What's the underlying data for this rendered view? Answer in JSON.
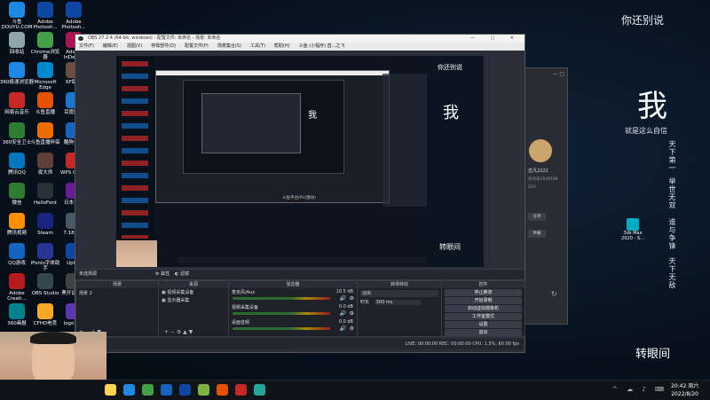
{
  "desktop": {
    "icons": [
      {
        "label": "斗鱼 DOUYU.COM",
        "color": "#1e88e5"
      },
      {
        "label": "Adobe Photosh...",
        "color": "#0d47a1"
      },
      {
        "label": "Adobe Photosh...",
        "color": "#0d47a1"
      },
      {
        "label": "回收站",
        "color": "#90a4ae"
      },
      {
        "label": "Chrome浏览器",
        "color": "#43a047"
      },
      {
        "label": "Adobe InDesi...",
        "color": "#ad1457"
      },
      {
        "label": "360极速浏览器",
        "color": "#1e88e5"
      },
      {
        "label": "Microsoft Edge",
        "color": "#0288d1"
      },
      {
        "label": "KF助手",
        "color": "#6d4c41"
      },
      {
        "label": "网易云音乐",
        "color": "#c62828"
      },
      {
        "label": "斗鱼直播",
        "color": "#e65100"
      },
      {
        "label": "百度网盘",
        "color": "#1976d2"
      },
      {
        "label": "360安全卫士",
        "color": "#2e7d32"
      },
      {
        "label": "斗鱼直播伴侣",
        "color": "#ef6c00"
      },
      {
        "label": "酷狗音乐",
        "color": "#1565c0"
      },
      {
        "label": "腾讯QQ",
        "color": "#0277bd"
      },
      {
        "label": "夜大师",
        "color": "#5d4037"
      },
      {
        "label": "WPS Office",
        "color": "#c62828"
      },
      {
        "label": "微信",
        "color": "#2e7d32"
      },
      {
        "label": "HelloFont",
        "color": "#263238"
      },
      {
        "label": "日本专题",
        "color": "#6a1b9a"
      },
      {
        "label": "腾讯视频",
        "color": "#ff8f00"
      },
      {
        "label": "Steam",
        "color": "#1a237e"
      },
      {
        "label": "7.18版本",
        "color": "#455a64"
      },
      {
        "label": "QQ游戏",
        "color": "#1565c0"
      },
      {
        "label": "iFonts字体助手",
        "color": "#283593"
      },
      {
        "label": "Uplay",
        "color": "#0d47a1"
      },
      {
        "label": "Adobe Creati...",
        "color": "#b71c1c"
      },
      {
        "label": "OBS Studio",
        "color": "#37474f"
      },
      {
        "label": "黑开设设计",
        "color": "#424242"
      },
      {
        "label": "360画报",
        "color": "#00838f"
      },
      {
        "label": "CFHD电竞",
        "color": "#f9a825"
      },
      {
        "label": "logo设计",
        "color": "#5e35b1"
      }
    ],
    "right_poem_title": "你还别说",
    "right_poem_big": "我",
    "right_poem_line": "就是这么自信",
    "right_poem_cols": [
      "天下第一",
      "举世无双",
      "谁与争锋",
      "天下无敌"
    ],
    "right_poem_footer": "转眼间",
    "max_icon": "3ds Max 2020 - S..."
  },
  "obs": {
    "title": "OBS 27.2.4 (64-bit, windows) - 配置文件: 未命名 - 场景: 未命名",
    "menu": [
      "文件(F)",
      "编辑(E)",
      "视图(V)",
      "停靠部件(D)",
      "配置文件(P)",
      "场景集合(S)",
      "工具(T)",
      "帮助(H)",
      "斗鱼 (小程序) 直...之飞"
    ],
    "nested_banner": "斗鱼平台(Pi)(激动)",
    "no_source": "未选择源",
    "props_label": "属性",
    "filter_label": "滤镜",
    "docks": {
      "scenes": "场景",
      "sources": "来源",
      "mixer": "混音器",
      "transitions": "转场特效",
      "controls": "控件"
    },
    "scene_items": [
      "场景 2"
    ],
    "source_items": [
      "视频采集设备",
      "显示器采集"
    ],
    "mixer_channels": [
      {
        "name": "麦克风/Aux",
        "db": "10.5 dB"
      },
      {
        "name": "视频采集设备",
        "db": "0.0 dB"
      },
      {
        "name": "桌面音频",
        "db": "0.0 dB"
      }
    ],
    "transition": {
      "value": "淡出",
      "duration_label": "时长",
      "duration": "300 ms"
    },
    "controls": [
      "停止推流",
      "开始录制",
      "启动虚拟摄像机",
      "工作室模式",
      "设置",
      "退出"
    ],
    "status": "LIVE: 00:00:00   REC: 00:00:00   CPU: 1.5%, 60.00 fps"
  },
  "floating": {
    "username": "志凡2222",
    "id": "房间号1949199",
    "followers": "263",
    "btn_share": "分享",
    "btn_report": "举报"
  },
  "tray": {
    "time": "20:42",
    "day": "周六",
    "date": "2022/8/20"
  }
}
